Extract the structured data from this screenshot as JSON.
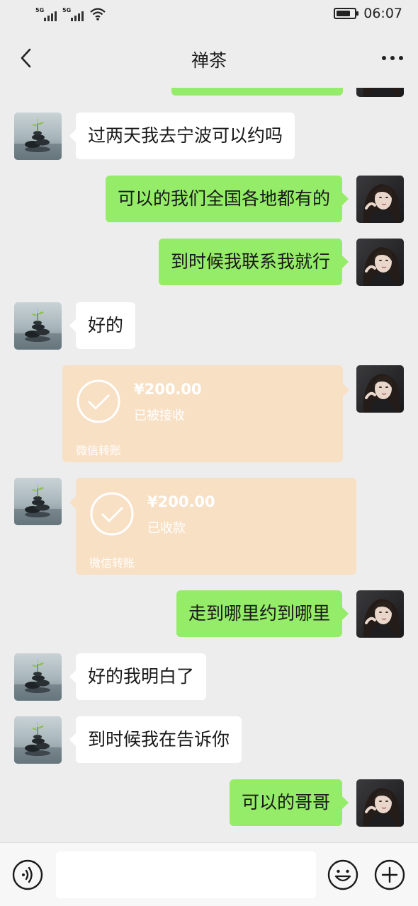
{
  "status_bar": {
    "signal_1": "5G",
    "signal_2": "5G",
    "time": "06:07",
    "battery_level": 0.8
  },
  "header": {
    "title": "禅茶",
    "back_icon": "chevron-left-icon",
    "more_icon": "more-dots-icon"
  },
  "messages": [
    {
      "from": "contact",
      "type": "text",
      "text": "过两天我去宁波可以约吗"
    },
    {
      "from": "me",
      "type": "text",
      "text": "可以的我们全国各地都有的"
    },
    {
      "from": "me",
      "type": "text",
      "text": "到时候我联系我就行"
    },
    {
      "from": "contact",
      "type": "text",
      "text": "好的"
    },
    {
      "from": "me",
      "type": "transfer",
      "amount": "¥200.00",
      "status": "已被接收",
      "label": "微信转账"
    },
    {
      "from": "contact",
      "type": "transfer",
      "amount": "¥200.00",
      "status": "已收款",
      "label": "微信转账"
    },
    {
      "from": "me",
      "type": "text",
      "text": "走到哪里约到哪里"
    },
    {
      "from": "contact",
      "type": "text",
      "text": "好的我明白了"
    },
    {
      "from": "contact",
      "type": "text",
      "text": "到时候我在告诉你"
    },
    {
      "from": "me",
      "type": "text",
      "text": "可以的哥哥"
    }
  ],
  "input_bar": {
    "voice_icon": "voice-icon",
    "input_value": "",
    "emoji_icon": "emoji-icon",
    "plus_icon": "plus-icon"
  },
  "colors": {
    "background": "#ededed",
    "sent_bubble": "#95ec69",
    "received_bubble": "#ffffff",
    "transfer_bubble": "#f8e0c4"
  }
}
